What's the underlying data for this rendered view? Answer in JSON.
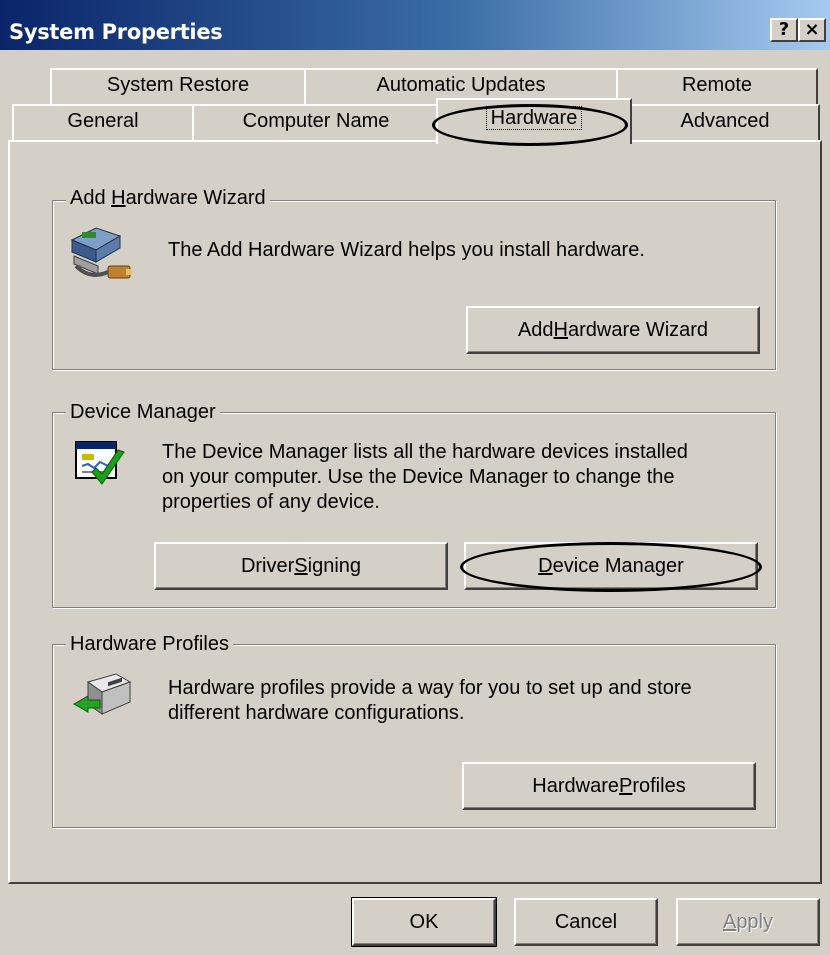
{
  "window": {
    "title": "System Properties",
    "help_label": "?",
    "close_label": "×"
  },
  "tabs": {
    "row1": [
      "System Restore",
      "Automatic Updates",
      "Remote"
    ],
    "row2": [
      "General",
      "Computer Name",
      "Hardware",
      "Advanced"
    ],
    "selected": "Hardware"
  },
  "add_hardware": {
    "title_pre": "Add ",
    "title_key": "H",
    "title_post": "ardware Wizard",
    "description": "The Add Hardware Wizard helps you install hardware.",
    "icon": "hardware-wizard-icon",
    "button_pre": "Add ",
    "button_key": "H",
    "button_post": "ardware Wizard"
  },
  "device_manager": {
    "title": "Device Manager",
    "line1": "The Device Manager lists all the hardware devices installed",
    "line2": "on your computer. Use the Device Manager to change the",
    "line3": "properties of any device.",
    "icon": "device-manager-icon",
    "driver_pre": "Driver ",
    "driver_key": "S",
    "driver_post": "igning",
    "dm_key": "D",
    "dm_post": "evice Manager"
  },
  "hardware_profiles": {
    "title": "Hardware Profiles",
    "line1": "Hardware profiles provide a way for you to set up and store",
    "line2": "different hardware configurations.",
    "icon": "hardware-profiles-icon",
    "button_pre": "Hardware ",
    "button_key": "P",
    "button_post": "rofiles"
  },
  "footer": {
    "ok": "OK",
    "cancel": "Cancel",
    "apply_key": "A",
    "apply_post": "pply"
  },
  "colors": {
    "face": "#d4d0c8",
    "title_start": "#0a246a",
    "title_end": "#a6caf0"
  }
}
